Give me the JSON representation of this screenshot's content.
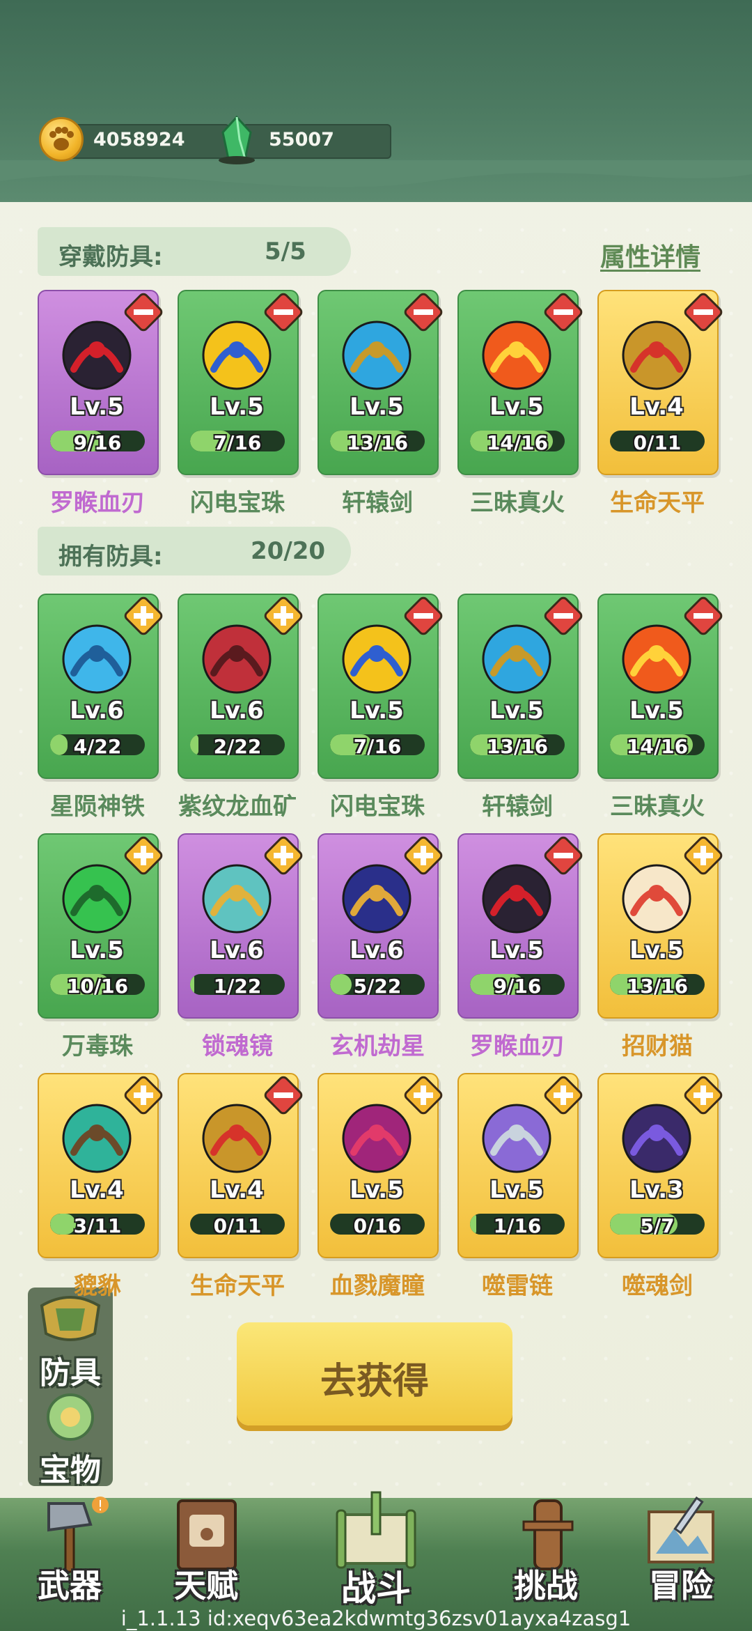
{
  "currencies": [
    {
      "icon": "paw-coin-icon",
      "value": "4058924"
    },
    {
      "icon": "green-crystal-icon",
      "value": "55007"
    }
  ],
  "equipped": {
    "title": "穿戴防具:",
    "count": "5/5"
  },
  "owned": {
    "title": "拥有防具:",
    "count": "20/20"
  },
  "attr_link": "属性详情",
  "equipped_items": [
    {
      "name": "罗睺血刃",
      "level": "Lv.5",
      "progress": "9/16",
      "rarity": "purple",
      "action": "remove",
      "art": "dark-sword"
    },
    {
      "name": "闪电宝珠",
      "level": "Lv.5",
      "progress": "7/16",
      "rarity": "green",
      "action": "remove",
      "art": "lightning-orb"
    },
    {
      "name": "轩辕剑",
      "level": "Lv.5",
      "progress": "13/16",
      "rarity": "green",
      "action": "remove",
      "art": "blue-sword"
    },
    {
      "name": "三昧真火",
      "level": "Lv.5",
      "progress": "14/16",
      "rarity": "green",
      "action": "remove",
      "art": "fire-orb"
    },
    {
      "name": "生命天平",
      "level": "Lv.4",
      "progress": "0/11",
      "rarity": "gold",
      "action": "remove",
      "art": "scales"
    }
  ],
  "owned_items": [
    {
      "name": "星陨神铁",
      "level": "Lv.6",
      "progress": "4/22",
      "rarity": "green",
      "action": "add",
      "art": "blue-crystal"
    },
    {
      "name": "紫纹龙血矿",
      "level": "Lv.6",
      "progress": "2/22",
      "rarity": "green",
      "action": "add",
      "art": "red-crystal"
    },
    {
      "name": "闪电宝珠",
      "level": "Lv.5",
      "progress": "7/16",
      "rarity": "green",
      "action": "remove",
      "art": "lightning-orb"
    },
    {
      "name": "轩辕剑",
      "level": "Lv.5",
      "progress": "13/16",
      "rarity": "green",
      "action": "remove",
      "art": "blue-sword"
    },
    {
      "name": "三昧真火",
      "level": "Lv.5",
      "progress": "14/16",
      "rarity": "green",
      "action": "remove",
      "art": "fire-orb"
    },
    {
      "name": "万毒珠",
      "level": "Lv.5",
      "progress": "10/16",
      "rarity": "green",
      "action": "add",
      "art": "green-orb"
    },
    {
      "name": "锁魂镜",
      "level": "Lv.6",
      "progress": "1/22",
      "rarity": "purple",
      "action": "add",
      "art": "yinyang-mirror"
    },
    {
      "name": "玄机劫星",
      "level": "Lv.6",
      "progress": "5/22",
      "rarity": "purple",
      "action": "add",
      "art": "star-orb"
    },
    {
      "name": "罗睺血刃",
      "level": "Lv.5",
      "progress": "9/16",
      "rarity": "purple",
      "action": "remove",
      "art": "dark-sword"
    },
    {
      "name": "招财猫",
      "level": "Lv.5",
      "progress": "13/16",
      "rarity": "gold",
      "action": "add",
      "art": "lucky-cat"
    },
    {
      "name": "貔貅",
      "level": "Lv.4",
      "progress": "3/11",
      "rarity": "gold",
      "action": "add",
      "art": "jade-beast"
    },
    {
      "name": "生命天平",
      "level": "Lv.4",
      "progress": "0/11",
      "rarity": "gold",
      "action": "remove",
      "art": "scales"
    },
    {
      "name": "血戮魔瞳",
      "level": "Lv.5",
      "progress": "0/16",
      "rarity": "gold",
      "action": "add",
      "art": "demon-eye"
    },
    {
      "name": "噬雷链",
      "level": "Lv.5",
      "progress": "1/16",
      "rarity": "gold",
      "action": "add",
      "art": "thunder-chain"
    },
    {
      "name": "噬魂剑",
      "level": "Lv.3",
      "progress": "5/7",
      "rarity": "gold",
      "action": "add",
      "art": "soul-sword"
    }
  ],
  "get_button": "去获得",
  "side_tabs": [
    {
      "label": "防具",
      "icon": "armor-icon"
    },
    {
      "label": "宝物",
      "icon": "treasure-icon"
    }
  ],
  "nav": [
    {
      "label": "武器",
      "icon": "axe-icon"
    },
    {
      "label": "天赋",
      "icon": "book-icon"
    },
    {
      "label": "战斗",
      "icon": "scroll-icon"
    },
    {
      "label": "挑战",
      "icon": "wooden-dummy-icon"
    },
    {
      "label": "冒险",
      "icon": "map-icon"
    }
  ],
  "footer": "i_1.1.13 id:xeqv63ea2kdwmtg36zsv01ayxa4zasg1",
  "colors": {
    "green": "#48a64f",
    "purple": "#a763c3",
    "gold": "#f2bf3b",
    "remove": "#e0453f",
    "add": "#f5b731"
  }
}
